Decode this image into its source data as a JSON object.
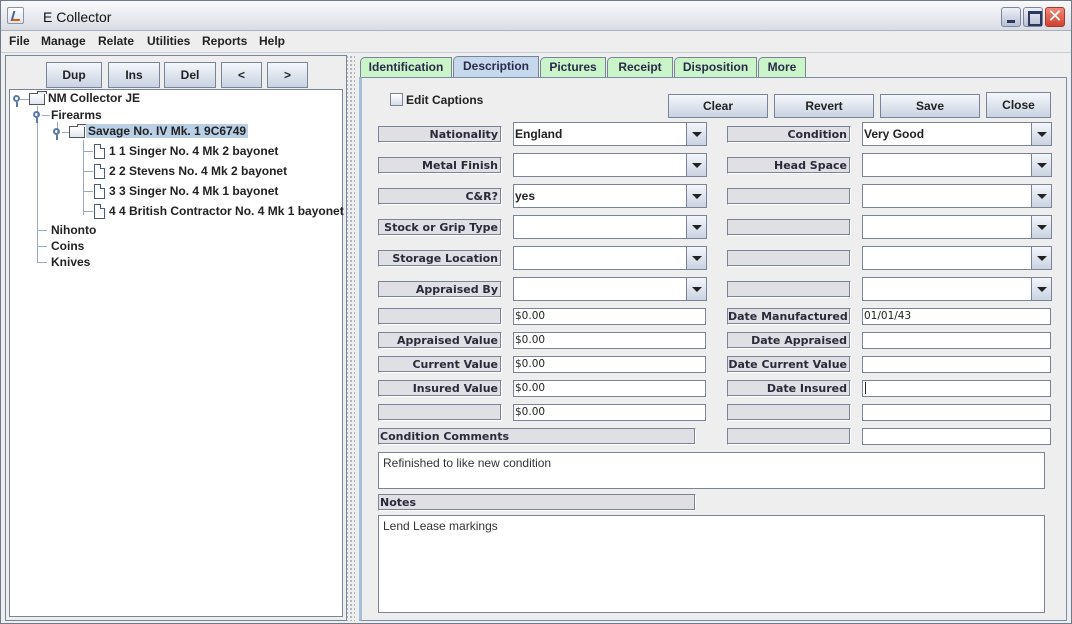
{
  "window": {
    "title": "E Collector",
    "controls": {
      "minimize": "_",
      "maximize": "□",
      "close": "✕"
    }
  },
  "menubar": [
    "File",
    "Manage",
    "Relate",
    "Utilities",
    "Reports",
    "Help"
  ],
  "tree_toolbar": {
    "dup": "Dup",
    "ins": "Ins",
    "del": "Del",
    "prev": "<",
    "next": ">"
  },
  "tree": {
    "root": "NM Collector JE",
    "firearms": "Firearms",
    "selected_item": "Savage No. IV Mk. 1 9C6749",
    "children": [
      "1 1 Singer No. 4 Mk 2 bayonet",
      "2 2 Stevens No. 4 Mk 2 bayonet",
      "3 3 Singer No. 4 Mk 1 bayonet",
      "4 4 British Contractor No. 4 Mk 1 bayonet"
    ],
    "categories": [
      "Nihonto",
      "Coins",
      "Knives"
    ]
  },
  "tabs": [
    "Identification",
    "Description",
    "Pictures",
    "Receipt",
    "Disposition",
    "More"
  ],
  "active_tab": "Description",
  "form": {
    "edit_captions_label": "Edit Captions",
    "edit_captions_checked": false,
    "buttons": {
      "clear": "Clear",
      "revert": "Revert",
      "save": "Save",
      "close": "Close"
    },
    "left_combos": [
      {
        "label": "Nationality",
        "value": "England"
      },
      {
        "label": "Metal Finish",
        "value": ""
      },
      {
        "label": "C&R?",
        "value": "yes"
      },
      {
        "label": "Stock or Grip Type",
        "value": ""
      },
      {
        "label": "Storage Location",
        "value": ""
      },
      {
        "label": "Appraised By",
        "value": ""
      }
    ],
    "right_combos": [
      {
        "label": "Condition",
        "value": "Very Good"
      },
      {
        "label": "Head Space",
        "value": ""
      },
      {
        "label": "",
        "value": ""
      },
      {
        "label": "",
        "value": ""
      },
      {
        "label": "",
        "value": ""
      },
      {
        "label": "",
        "value": ""
      }
    ],
    "left_values": [
      {
        "label": "",
        "value": "$0.00"
      },
      {
        "label": "Appraised Value",
        "value": "$0.00"
      },
      {
        "label": "Current Value",
        "value": "$0.00"
      },
      {
        "label": "Insured Value",
        "value": "$0.00"
      },
      {
        "label": "",
        "value": "$0.00"
      }
    ],
    "right_dates": [
      {
        "label": "Date Manufactured",
        "value": "01/01/43"
      },
      {
        "label": "Date Appraised",
        "value": ""
      },
      {
        "label": "Date Current Value",
        "value": ""
      },
      {
        "label": "Date Insured",
        "value": ""
      },
      {
        "label": "",
        "value": ""
      },
      {
        "label": "",
        "value": ""
      }
    ],
    "condition_comments_label": "Condition Comments",
    "condition_comments": "Refinished to like new condition",
    "notes_label": "Notes",
    "notes": "Lend Lease markings"
  }
}
